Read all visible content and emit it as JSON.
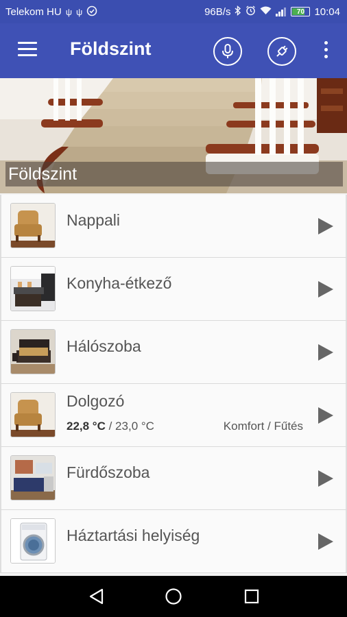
{
  "status_bar": {
    "carrier": "Telekom HU",
    "net_speed": "96B/s",
    "battery": "70",
    "time": "10:04",
    "icons": [
      "usb-icon",
      "usb-icon",
      "check-circle-icon",
      "bluetooth-icon",
      "alarm-icon",
      "wifi-icon",
      "signal-icon",
      "battery-icon"
    ]
  },
  "app_bar": {
    "title": "Földszint",
    "icons": [
      "menu-icon",
      "microphone-icon",
      "plug-icon",
      "more-vert-icon"
    ]
  },
  "hero": {
    "caption": "Földszint"
  },
  "rooms": [
    {
      "name": "Nappali",
      "thumb": "armchair-icon"
    },
    {
      "name": "Konyha-étkező",
      "thumb": "kitchen-icon"
    },
    {
      "name": "Hálószoba",
      "thumb": "bed-icon"
    },
    {
      "name": "Dolgozó",
      "thumb": "armchair-icon",
      "temp_current": "22,8 °C",
      "temp_target": " / 23,0 °C",
      "mode": "Komfort / Fűtés"
    },
    {
      "name": "Fürdőszoba",
      "thumb": "bathroom-icon"
    },
    {
      "name": "Háztartási helyiség",
      "thumb": "washing-machine-icon"
    }
  ],
  "nav_bar": {
    "icons": [
      "back-icon",
      "home-icon",
      "recents-icon"
    ]
  },
  "colors": {
    "status_bar": "#3b4eb0",
    "app_bar": "#3f51b5",
    "list_bg": "#fafafa",
    "arrow": "#666666"
  }
}
